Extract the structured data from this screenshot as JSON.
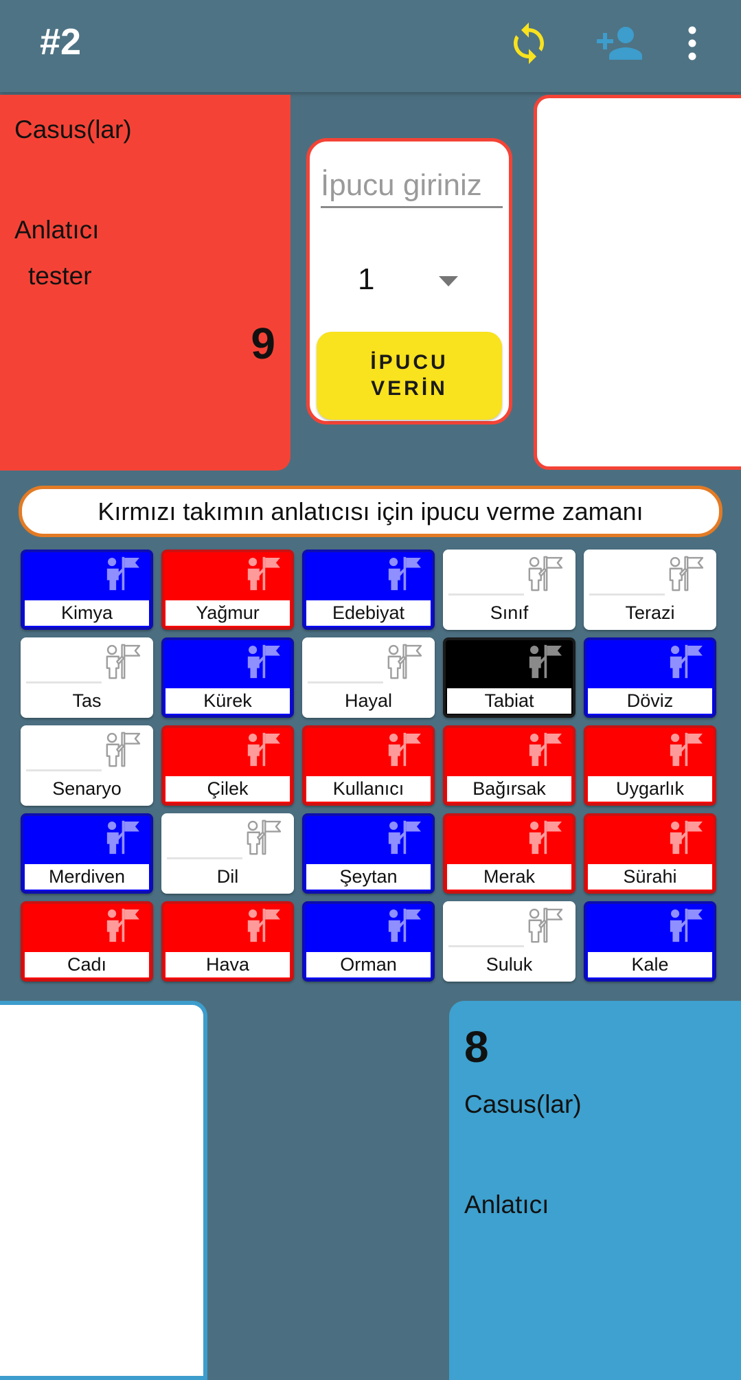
{
  "header": {
    "title": "#2",
    "refresh_icon": "refresh-icon",
    "add_player_icon": "add-person-icon",
    "menu_icon": "more-vert-icon",
    "refresh_color": "#f9e21e",
    "add_player_color": "#3d9dcc"
  },
  "red_team": {
    "spies_label": "Casus(lar)",
    "narrator_label": "Anlatıcı",
    "narrator_name": "tester",
    "remaining": "9",
    "color": "#f44336"
  },
  "clue_form": {
    "placeholder": "İpucu giriniz",
    "count_value": "1",
    "submit_label": "İPUCU VERİN"
  },
  "status_message": "Kırmızı takımın anlatıcısı için ipucu verme zamanı",
  "board": {
    "colors": {
      "red": "#ff0000",
      "blue": "#0000ff",
      "neutral": "#ffffff",
      "assassin": "#000000"
    },
    "cards": [
      {
        "word": "Kimya",
        "team": "blue"
      },
      {
        "word": "Yağmur",
        "team": "red"
      },
      {
        "word": "Edebiyat",
        "team": "blue"
      },
      {
        "word": "Sınıf",
        "team": "neutral"
      },
      {
        "word": "Terazi",
        "team": "neutral"
      },
      {
        "word": "Tas",
        "team": "neutral"
      },
      {
        "word": "Kürek",
        "team": "blue"
      },
      {
        "word": "Hayal",
        "team": "neutral"
      },
      {
        "word": "Tabiat",
        "team": "assassin"
      },
      {
        "word": "Döviz",
        "team": "blue"
      },
      {
        "word": "Senaryo",
        "team": "neutral"
      },
      {
        "word": "Çilek",
        "team": "red"
      },
      {
        "word": "Kullanıcı",
        "team": "red"
      },
      {
        "word": "Bağırsak",
        "team": "red"
      },
      {
        "word": "Uygarlık",
        "team": "red"
      },
      {
        "word": "Merdiven",
        "team": "blue"
      },
      {
        "word": "Dil",
        "team": "neutral"
      },
      {
        "word": "Şeytan",
        "team": "blue"
      },
      {
        "word": "Merak",
        "team": "red"
      },
      {
        "word": "Sürahi",
        "team": "red"
      },
      {
        "word": "Cadı",
        "team": "red"
      },
      {
        "word": "Hava",
        "team": "red"
      },
      {
        "word": "Orman",
        "team": "blue"
      },
      {
        "word": "Suluk",
        "team": "neutral"
      },
      {
        "word": "Kale",
        "team": "blue"
      }
    ]
  },
  "blue_team": {
    "remaining": "8",
    "spies_label": "Casus(lar)",
    "narrator_label": "Anlatıcı",
    "color": "#3ea1cf"
  }
}
